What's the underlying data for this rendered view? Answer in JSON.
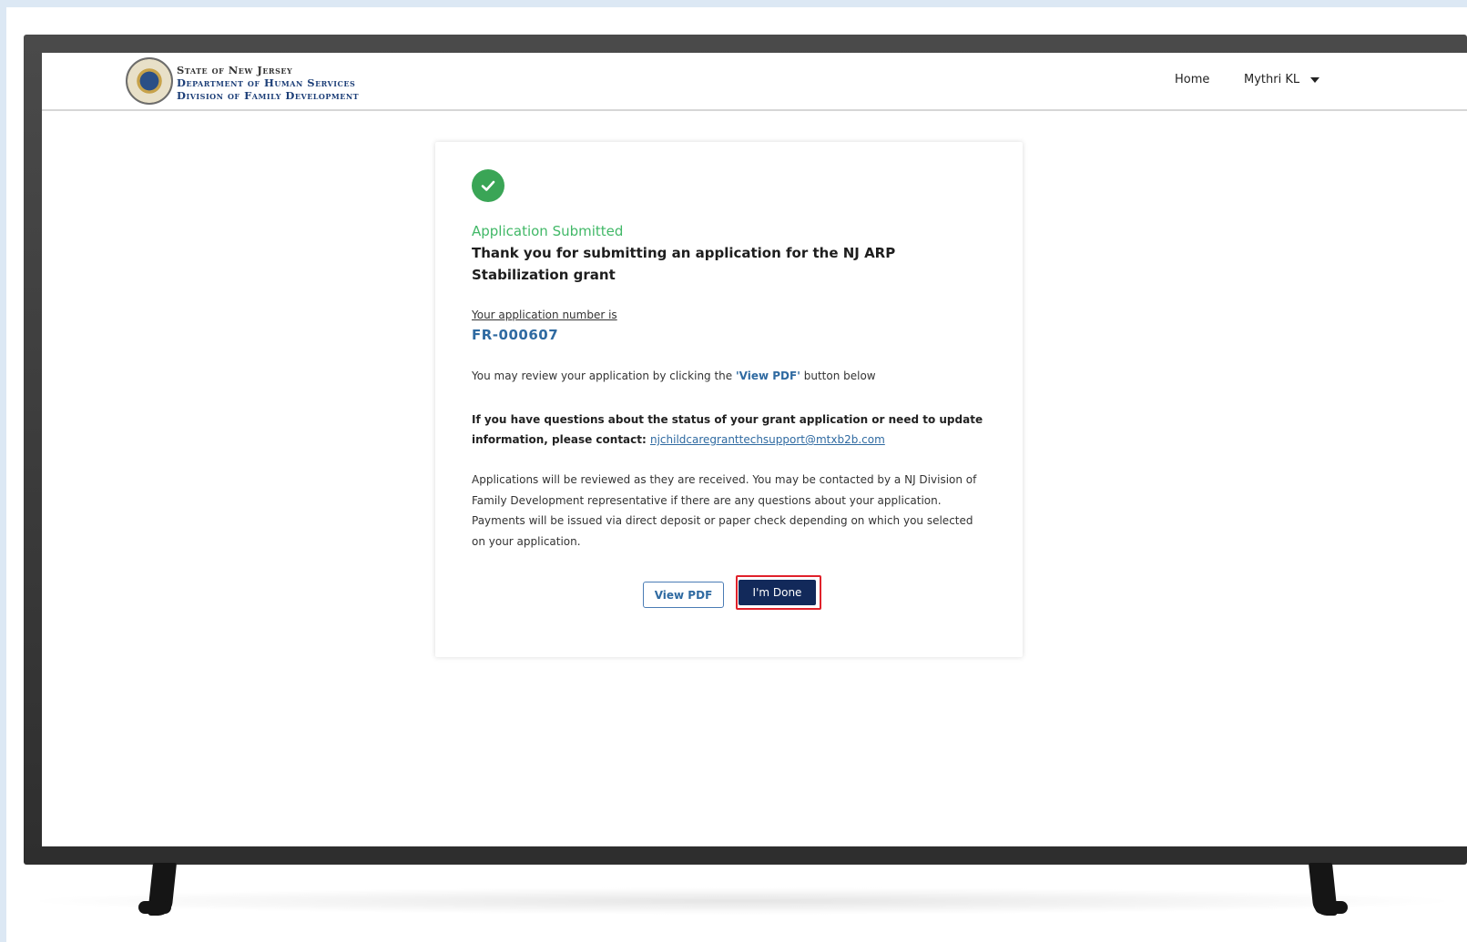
{
  "header": {
    "org_line1": "State of New Jersey",
    "org_line2": "Department of Human Services",
    "org_line3": "Division of Family Development",
    "nav_home": "Home",
    "user_name": "Mythri KL"
  },
  "confirmation": {
    "status": "Application Submitted",
    "thanks": "Thank you for submitting an application for the NJ ARP Stabilization grant",
    "app_number_label": "Your application number is",
    "app_number": "FR-000607",
    "review_before": "You may review your application by clicking the ",
    "review_link": "'View PDF'",
    "review_after": " button below",
    "contact_text": "If you have questions about the status of your grant application or need to update information, please contact: ",
    "contact_email": "njchildcaregranttechsupport@mtxb2b.com",
    "info": "Applications will be reviewed as they are received. You may be contacted by a NJ Division of Family Development representative if there are any questions about your application. Payments will be issued via direct deposit or paper check depending on which you selected on your application."
  },
  "buttons": {
    "view_pdf": "View PDF",
    "done": "I'm Done"
  },
  "colors": {
    "success": "#3aa556",
    "link": "#2f6aa1",
    "primary": "#12295a",
    "highlight": "#e0212a"
  }
}
